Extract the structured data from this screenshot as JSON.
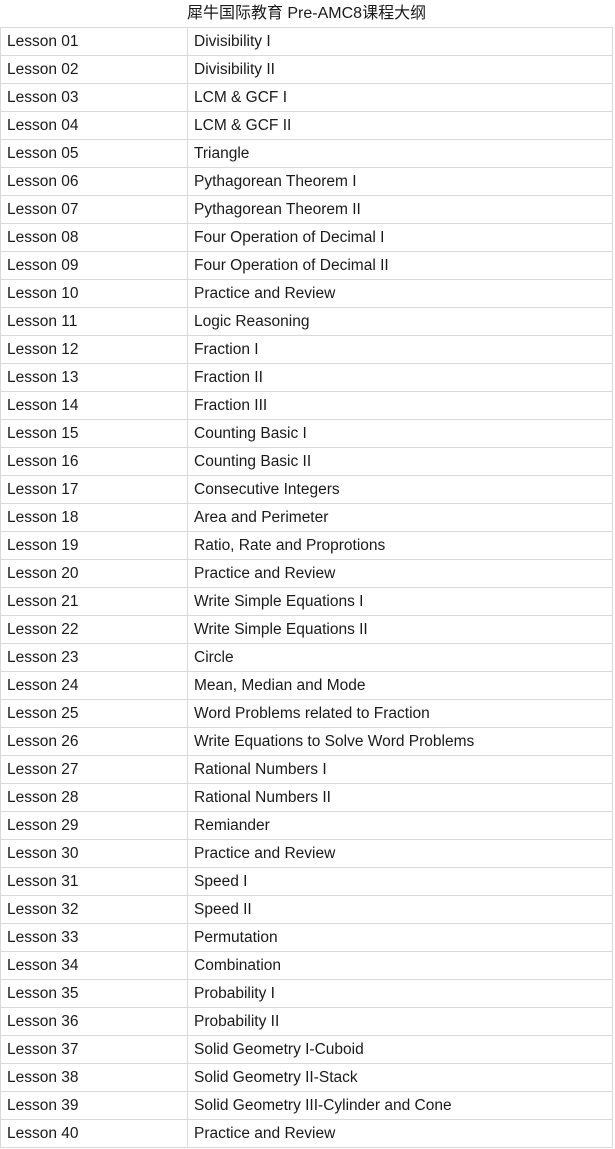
{
  "document": {
    "title": "犀牛国际教育 Pre-AMC8课程大纲",
    "colors": {
      "border": "#d9d9d9",
      "text": "#1a1a1a",
      "background": "#ffffff"
    },
    "columns": {
      "lesson_header": "",
      "topic_header": ""
    },
    "rows": [
      {
        "lesson": "Lesson 01",
        "topic": "Divisibility I"
      },
      {
        "lesson": "Lesson 02",
        "topic": "Divisibility II"
      },
      {
        "lesson": "Lesson 03",
        "topic": "LCM & GCF I"
      },
      {
        "lesson": "Lesson 04",
        "topic": "LCM & GCF II"
      },
      {
        "lesson": "Lesson 05",
        "topic": "Triangle"
      },
      {
        "lesson": "Lesson 06",
        "topic": "Pythagorean Theorem I"
      },
      {
        "lesson": "Lesson 07",
        "topic": "Pythagorean Theorem II"
      },
      {
        "lesson": "Lesson 08",
        "topic": "Four Operation of Decimal I"
      },
      {
        "lesson": "Lesson 09",
        "topic": "Four Operation of Decimal II"
      },
      {
        "lesson": "Lesson 10",
        "topic": "Practice and Review"
      },
      {
        "lesson": "Lesson 11",
        "topic": "Logic Reasoning"
      },
      {
        "lesson": "Lesson 12",
        "topic": "Fraction I"
      },
      {
        "lesson": "Lesson 13",
        "topic": "Fraction II"
      },
      {
        "lesson": "Lesson 14",
        "topic": "Fraction III"
      },
      {
        "lesson": "Lesson 15",
        "topic": "Counting Basic I"
      },
      {
        "lesson": "Lesson 16",
        "topic": "Counting Basic II"
      },
      {
        "lesson": "Lesson 17",
        "topic": "Consecutive Integers"
      },
      {
        "lesson": "Lesson 18",
        "topic": "Area and Perimeter"
      },
      {
        "lesson": "Lesson 19",
        "topic": "Ratio, Rate and Proprotions"
      },
      {
        "lesson": "Lesson 20",
        "topic": "Practice and Review"
      },
      {
        "lesson": "Lesson 21",
        "topic": "Write Simple Equations I"
      },
      {
        "lesson": "Lesson 22",
        "topic": "Write Simple Equations II"
      },
      {
        "lesson": "Lesson 23",
        "topic": "Circle"
      },
      {
        "lesson": "Lesson 24",
        "topic": "Mean, Median and Mode"
      },
      {
        "lesson": "Lesson 25",
        "topic": "Word Problems related to Fraction"
      },
      {
        "lesson": "Lesson 26",
        "topic": "Write Equations to Solve Word Problems"
      },
      {
        "lesson": "Lesson 27",
        "topic": "Rational Numbers I"
      },
      {
        "lesson": "Lesson 28",
        "topic": "Rational Numbers II"
      },
      {
        "lesson": "Lesson 29",
        "topic": "Remiander"
      },
      {
        "lesson": "Lesson 30",
        "topic": "Practice and Review"
      },
      {
        "lesson": "Lesson 31",
        "topic": "Speed I"
      },
      {
        "lesson": "Lesson 32",
        "topic": "Speed II"
      },
      {
        "lesson": "Lesson 33",
        "topic": "Permutation"
      },
      {
        "lesson": "Lesson 34",
        "topic": "Combination"
      },
      {
        "lesson": "Lesson 35",
        "topic": "Probability I"
      },
      {
        "lesson": "Lesson 36",
        "topic": "Probability II"
      },
      {
        "lesson": "Lesson 37",
        "topic": "Solid Geometry I-Cuboid"
      },
      {
        "lesson": "Lesson 38",
        "topic": "Solid Geometry II-Stack"
      },
      {
        "lesson": "Lesson 39",
        "topic": "Solid Geometry III-Cylinder and Cone"
      },
      {
        "lesson": "Lesson 40",
        "topic": "Practice and Review"
      }
    ]
  }
}
